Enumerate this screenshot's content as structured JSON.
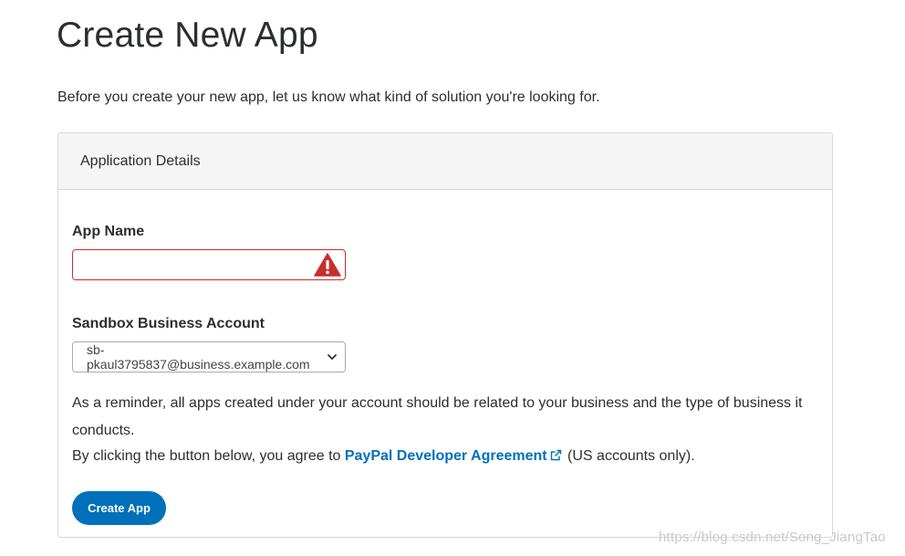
{
  "page": {
    "title": "Create New App",
    "intro": "Before you create your new app, let us know what kind of solution you're looking for."
  },
  "card": {
    "header": "Application Details",
    "app_name": {
      "label": "App Name",
      "value": "",
      "status_icon": "warning-triangle-icon",
      "error_color": "#c72e2e"
    },
    "sandbox_account": {
      "label": "Sandbox Business Account",
      "selected": "sb-pkaul3795837@business.example.com",
      "icon": "chevron-down-icon"
    },
    "reminder": "As a reminder, all apps created under your account should be related to your business and the type of business it conducts.",
    "agreement": {
      "prefix": "By clicking the button below, you agree to ",
      "link": "PayPal Developer Agreement",
      "link_icon": "external-link-icon",
      "suffix": " (US accounts only)."
    },
    "create_button": "Create App"
  },
  "colors": {
    "accent": "#0070ba",
    "error": "#c72e2e",
    "header_bg": "#f5f5f5"
  },
  "watermark": "https://blog.csdn.net/Song_JiangTao"
}
